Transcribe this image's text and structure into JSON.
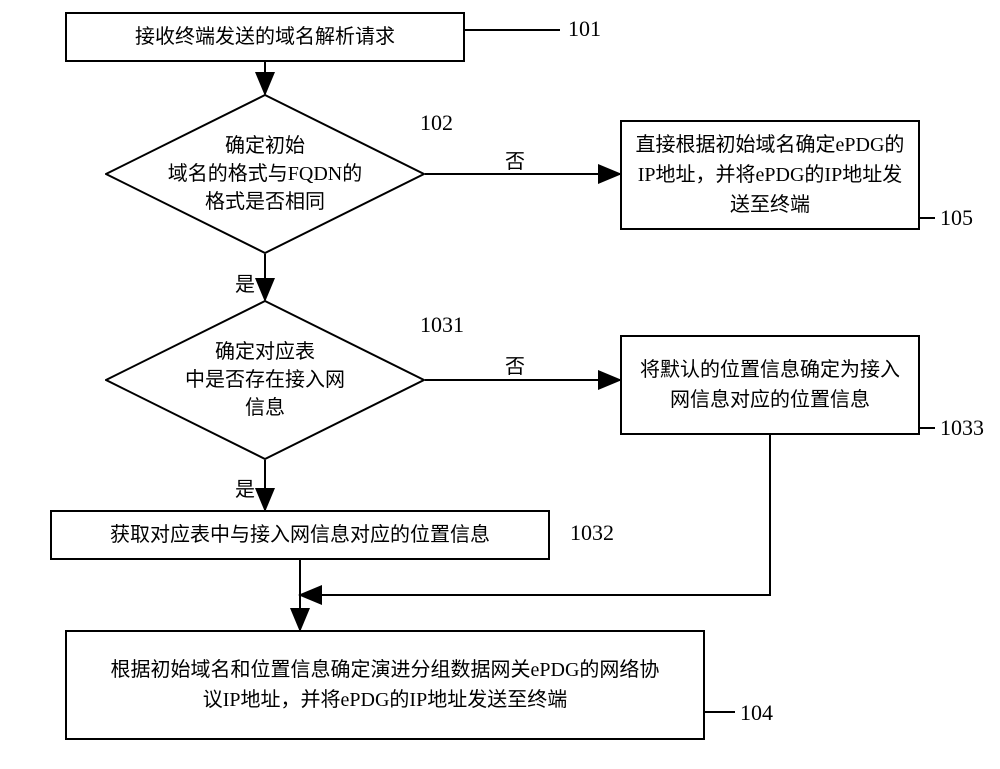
{
  "steps": {
    "s101": {
      "text": "接收终端发送的域名解析请求",
      "num": "101"
    },
    "s102": {
      "text": "确定初始\n域名的格式与FQDN的\n格式是否相同",
      "num": "102"
    },
    "s105": {
      "text": "直接根据初始域名确定ePDG的IP地址，并将ePDG的IP地址发送至终端",
      "num": "105"
    },
    "s1031": {
      "text": "确定对应表\n中是否存在接入网\n信息",
      "num": "1031"
    },
    "s1033": {
      "text": "将默认的位置信息确定为接入网信息对应的位置信息",
      "num": "1033"
    },
    "s1032": {
      "text": "获取对应表中与接入网信息对应的位置信息",
      "num": "1032"
    },
    "s104": {
      "text": "根据初始域名和位置信息确定演进分组数据网关ePDG的网络协议IP地址，并将ePDG的IP地址发送至终端",
      "num": "104"
    }
  },
  "edges": {
    "yes": "是",
    "no": "否"
  }
}
